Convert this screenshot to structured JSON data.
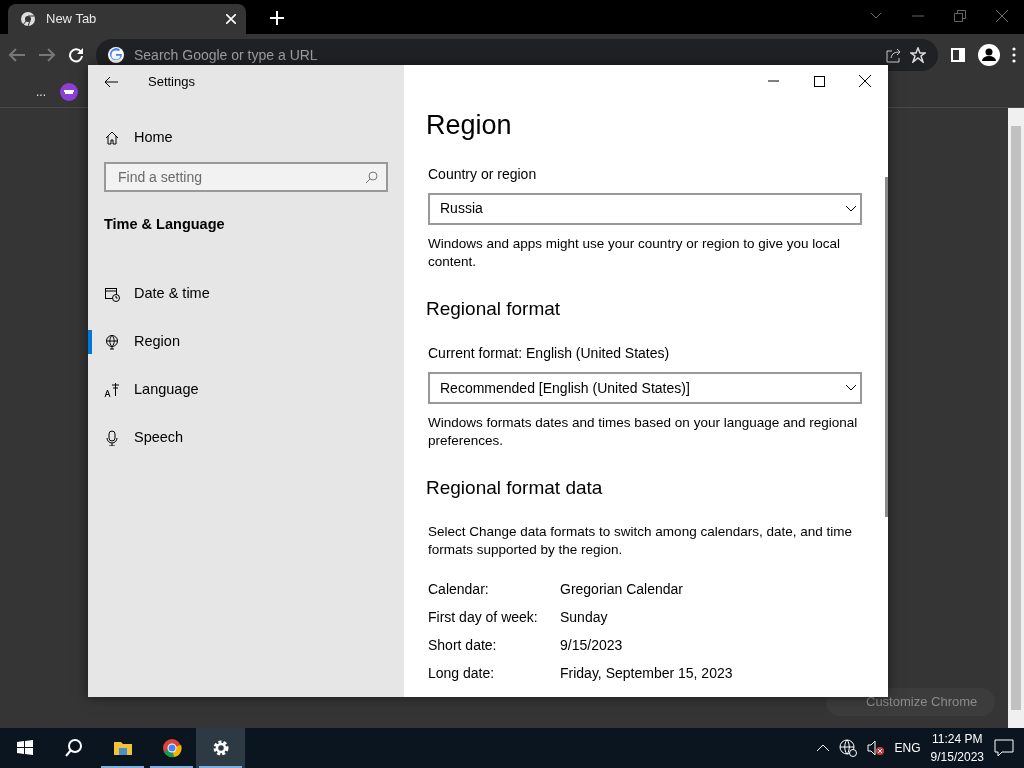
{
  "browser": {
    "tab": {
      "title": "New Tab",
      "selected": true
    },
    "address_bar": {
      "placeholder": "Search Google or type a URL"
    },
    "bookmarks_overflow": "...",
    "customize_button": "Customize Chrome"
  },
  "settings": {
    "title": "Settings",
    "home": "Home",
    "search": {
      "placeholder": "Find a setting"
    },
    "section": "Time & Language",
    "nav": [
      {
        "label": "Date & time",
        "kind": "clock",
        "selected": false
      },
      {
        "label": "Region",
        "kind": "globe",
        "selected": true
      },
      {
        "label": "Language",
        "kind": "language",
        "selected": false
      },
      {
        "label": "Speech",
        "kind": "mic",
        "selected": false
      }
    ],
    "page": {
      "heading": "Region",
      "blocks": [
        {
          "kind": "label",
          "text": "Country or region"
        },
        {
          "kind": "dropdown",
          "value": "Russia"
        },
        {
          "kind": "text",
          "text": "Windows and apps might use your country or region to give you local content."
        },
        {
          "kind": "heading",
          "text": "Regional format"
        },
        {
          "kind": "label",
          "text": "Current format: English (United States)"
        },
        {
          "kind": "dropdown",
          "value": "Recommended [English (United States)]"
        },
        {
          "kind": "text",
          "text": "Windows formats dates and times based on your language and regional preferences."
        },
        {
          "kind": "heading",
          "text": "Regional format data"
        },
        {
          "kind": "text",
          "text": "Select Change data formats to switch among calendars, date, and time formats supported by the region."
        }
      ],
      "format_data": [
        {
          "label": "Calendar:",
          "value": "Gregorian Calendar"
        },
        {
          "label": "First day of week:",
          "value": "Sunday"
        },
        {
          "label": "Short date:",
          "value": "9/15/2023"
        },
        {
          "label": "Long date:",
          "value": "Friday, September 15, 2023"
        }
      ]
    }
  },
  "taskbar": {
    "apps": [
      {
        "kind": "start",
        "selected": false
      },
      {
        "kind": "search",
        "selected": false
      },
      {
        "kind": "folder",
        "selected": false
      },
      {
        "kind": "chrome",
        "selected": false
      },
      {
        "kind": "settings",
        "selected": true
      }
    ],
    "language": "ENG",
    "time": "11:24 PM",
    "date": "9/15/2023"
  }
}
